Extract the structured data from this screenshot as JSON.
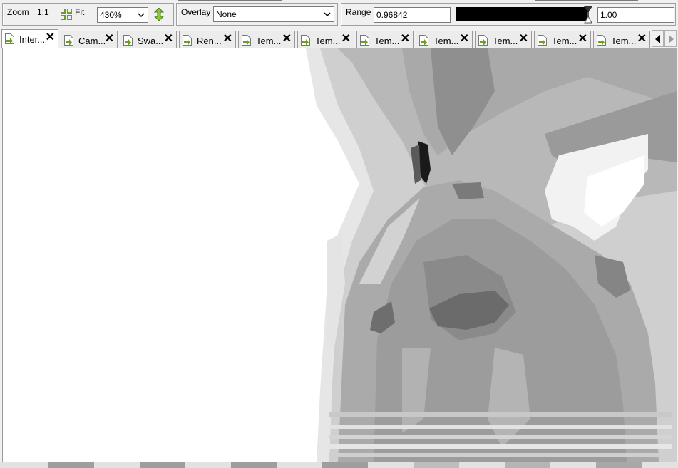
{
  "toolbar": {
    "zoom_label": "Zoom",
    "one_to_one": "1:1",
    "fit_label": "Fit",
    "zoom_value": "430%",
    "overlay_label": "Overlay",
    "overlay_value": "None",
    "range_label": "Range",
    "range_min": "0.96842",
    "range_max": "1.00"
  },
  "tabs": [
    {
      "label": "Inter..."
    },
    {
      "label": "Cam..."
    },
    {
      "label": "Swa..."
    },
    {
      "label": "Ren..."
    },
    {
      "label": "Tem..."
    },
    {
      "label": "Tem..."
    },
    {
      "label": "Tem..."
    },
    {
      "label": "Tem..."
    },
    {
      "label": "Tem..."
    },
    {
      "label": "Tem..."
    },
    {
      "label": "Tem..."
    }
  ],
  "colors": {
    "accent_green": "#6aa121",
    "range_bar": "#000000"
  },
  "icons": [
    "fit-icon",
    "swap-icon",
    "tab-texture-icon",
    "close-icon",
    "scroll-left-icon",
    "scroll-right-icon"
  ]
}
